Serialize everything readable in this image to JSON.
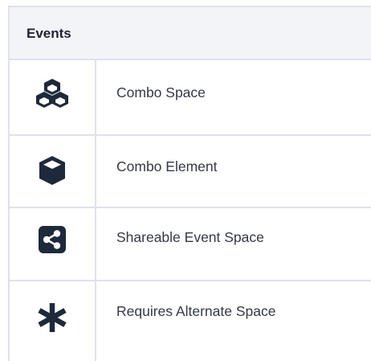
{
  "header": {
    "title": "Events"
  },
  "rows": [
    {
      "icon": "cubes-icon",
      "label": "Combo Space"
    },
    {
      "icon": "cube-icon",
      "label": "Combo Element"
    },
    {
      "icon": "share-square-icon",
      "label": "Shareable Event Space"
    },
    {
      "icon": "asterisk-icon",
      "label": "Requires Alternate Space"
    }
  ],
  "colors": {
    "header_bg": "#f3f4f8",
    "border": "#dfe2ea",
    "icon": "#1e2a3b",
    "text": "#333a46"
  }
}
